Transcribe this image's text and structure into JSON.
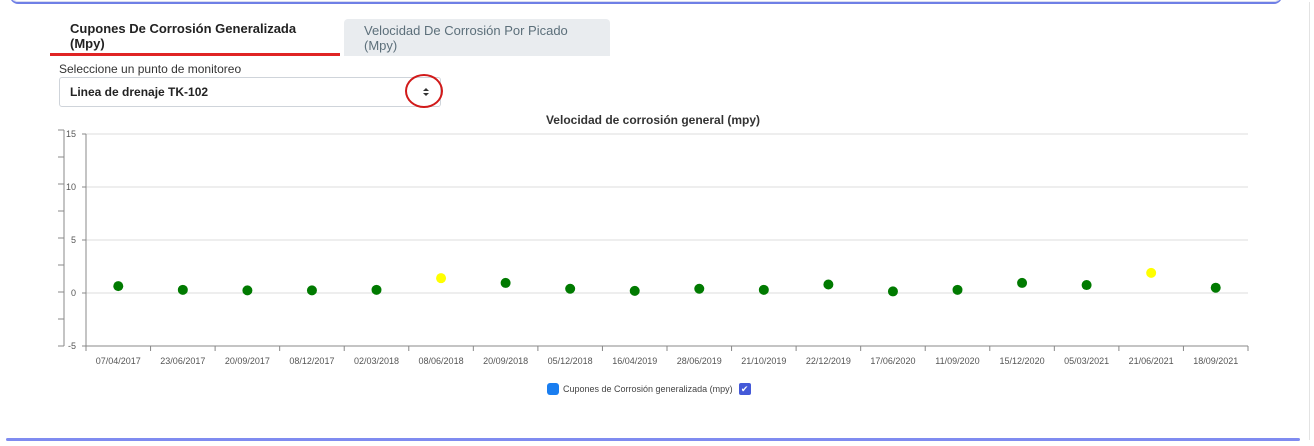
{
  "tabs": [
    {
      "label": "Cupones De Corrosión Generalizada (Mpy)",
      "active": true
    },
    {
      "label": "Velocidad De Corrosión Por Picado (Mpy)",
      "active": false
    }
  ],
  "monitoring": {
    "label": "Seleccione un punto de monitoreo",
    "selected": "Linea de drenaje TK-102"
  },
  "legend": {
    "label": "Cupones de Corrosión generalizada (mpy)",
    "check_glyph": "✔"
  },
  "chart_data": {
    "type": "scatter",
    "title": "Velocidad de corrosión general (mpy)",
    "xlabel": "",
    "ylabel": "",
    "ylim": [
      -5,
      15
    ],
    "yticks": [
      -5,
      0,
      5,
      10,
      15
    ],
    "grid": true,
    "legend_position": "bottom-center",
    "categories": [
      "07/04/2017",
      "23/06/2017",
      "20/09/2017",
      "08/12/2017",
      "02/03/2018",
      "08/06/2018",
      "20/09/2018",
      "05/12/2018",
      "16/04/2019",
      "28/06/2019",
      "21/10/2019",
      "22/12/2019",
      "17/06/2020",
      "11/09/2020",
      "15/12/2020",
      "05/03/2021",
      "21/06/2021",
      "18/09/2021"
    ],
    "series": [
      {
        "name": "Cupones de Corrosión generalizada (mpy)",
        "values": [
          0.65,
          0.3,
          0.25,
          0.25,
          0.3,
          1.4,
          0.95,
          0.4,
          0.2,
          0.4,
          0.3,
          0.8,
          0.15,
          0.3,
          0.95,
          0.75,
          1.9,
          0.5
        ],
        "colors": [
          "#007a00",
          "#007a00",
          "#007a00",
          "#007a00",
          "#007a00",
          "#ffff00",
          "#007a00",
          "#007a00",
          "#007a00",
          "#007a00",
          "#007a00",
          "#007a00",
          "#007a00",
          "#007a00",
          "#007a00",
          "#007a00",
          "#ffff00",
          "#007a00"
        ]
      }
    ]
  }
}
